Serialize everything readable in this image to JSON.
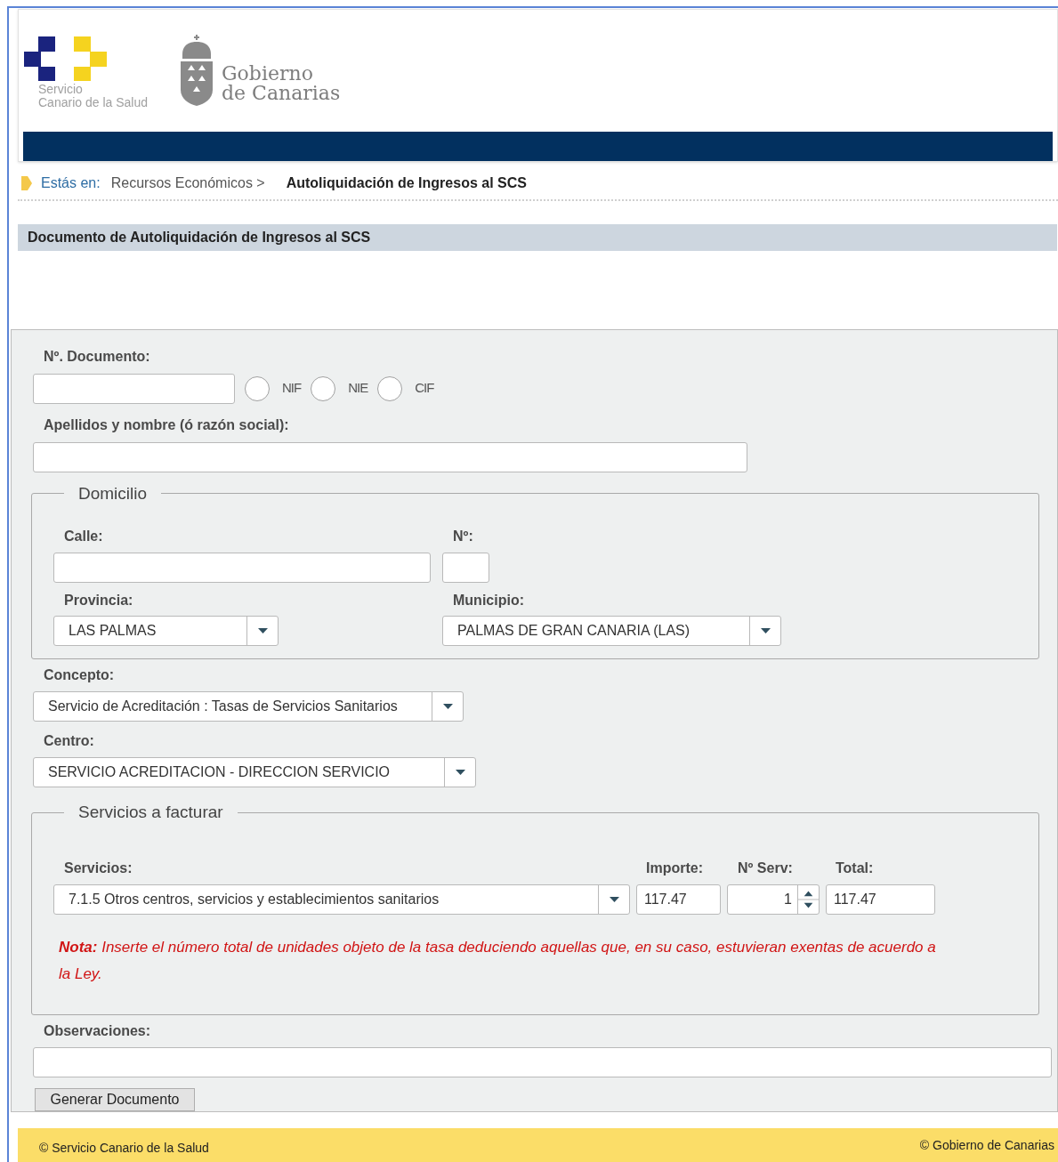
{
  "header": {
    "logo_left": {
      "line1": "Servicio",
      "line2": "Canario de la Salud"
    },
    "logo_right": {
      "line1": "Gobierno",
      "line2": "de Canarias"
    }
  },
  "breadcrumb": {
    "label": "Estás en:",
    "items": [
      {
        "text": "Recursos Económicos >",
        "current": false
      },
      {
        "text": "Autoliquidación de Ingresos al SCS",
        "current": true
      }
    ]
  },
  "section_title": "Documento de Autoliquidación de Ingresos al SCS",
  "form": {
    "documento": {
      "label": "Nº. Documento:",
      "types": [
        {
          "label": "NIF",
          "selected": false
        },
        {
          "label": "NIE",
          "selected": false
        },
        {
          "label": "CIF",
          "selected": false
        }
      ]
    },
    "nombre": {
      "label": "Apellidos y nombre (ó razón social):"
    },
    "domicilio": {
      "legend": "Domicilio",
      "calle": {
        "label": "Calle:"
      },
      "numero": {
        "label": "Nº:"
      },
      "provincia": {
        "label": "Provincia:",
        "value": "LAS PALMAS"
      },
      "municipio": {
        "label": "Municipio:",
        "value": "PALMAS DE GRAN CANARIA (LAS)"
      }
    },
    "concepto": {
      "label": "Concepto:",
      "value": "Servicio de Acreditación : Tasas de Servicios Sanitarios"
    },
    "centro": {
      "label": "Centro:",
      "value": "SERVICIO ACREDITACION - DIRECCION SERVICIO"
    },
    "servicios": {
      "legend": "Servicios a facturar",
      "servicio": {
        "label": "Servicios:",
        "value": "7.1.5 Otros centros, servicios y establecimientos sanitarios"
      },
      "importe": {
        "label": "Importe:",
        "value": "117.47"
      },
      "num_serv": {
        "label": "Nº Serv:",
        "value": "1"
      },
      "total": {
        "label": "Total:",
        "value": "117.47"
      },
      "note": "**Nota:** Inserte el número total de unidades objeto de la tasa deduciendo aquellas que, en su caso, estuvieran exentas de acuerdo a la Ley."
    },
    "observaciones": {
      "label": "Observaciones:"
    },
    "submit": "Generar Documento"
  },
  "footer": {
    "left": "© Servicio Canario de la Salud",
    "right": "© Gobierno de Canarias"
  }
}
